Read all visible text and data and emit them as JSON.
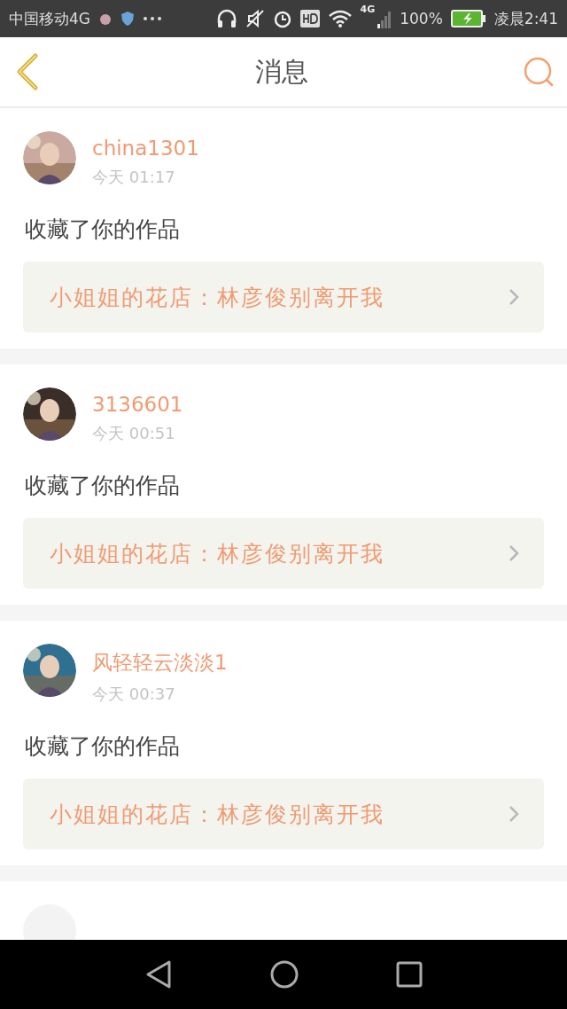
{
  "status_bar": {
    "carrier": "中国移动4G",
    "network": "4G",
    "battery": "100%",
    "time": "凌晨2:41"
  },
  "header": {
    "title": "消息"
  },
  "messages": [
    {
      "user": "china1301",
      "time": "今天 01:17",
      "action": "收藏了你的作品",
      "work": "小姐姐的花店：林彦俊别离开我"
    },
    {
      "user": "3136601",
      "time": "今天 00:51",
      "action": "收藏了你的作品",
      "work": "小姐姐的花店：林彦俊别离开我"
    },
    {
      "user": "风轻轻云淡淡1",
      "time": "今天 00:37",
      "action": "收藏了你的作品",
      "work": "小姐姐的花店：林彦俊别离开我"
    }
  ]
}
